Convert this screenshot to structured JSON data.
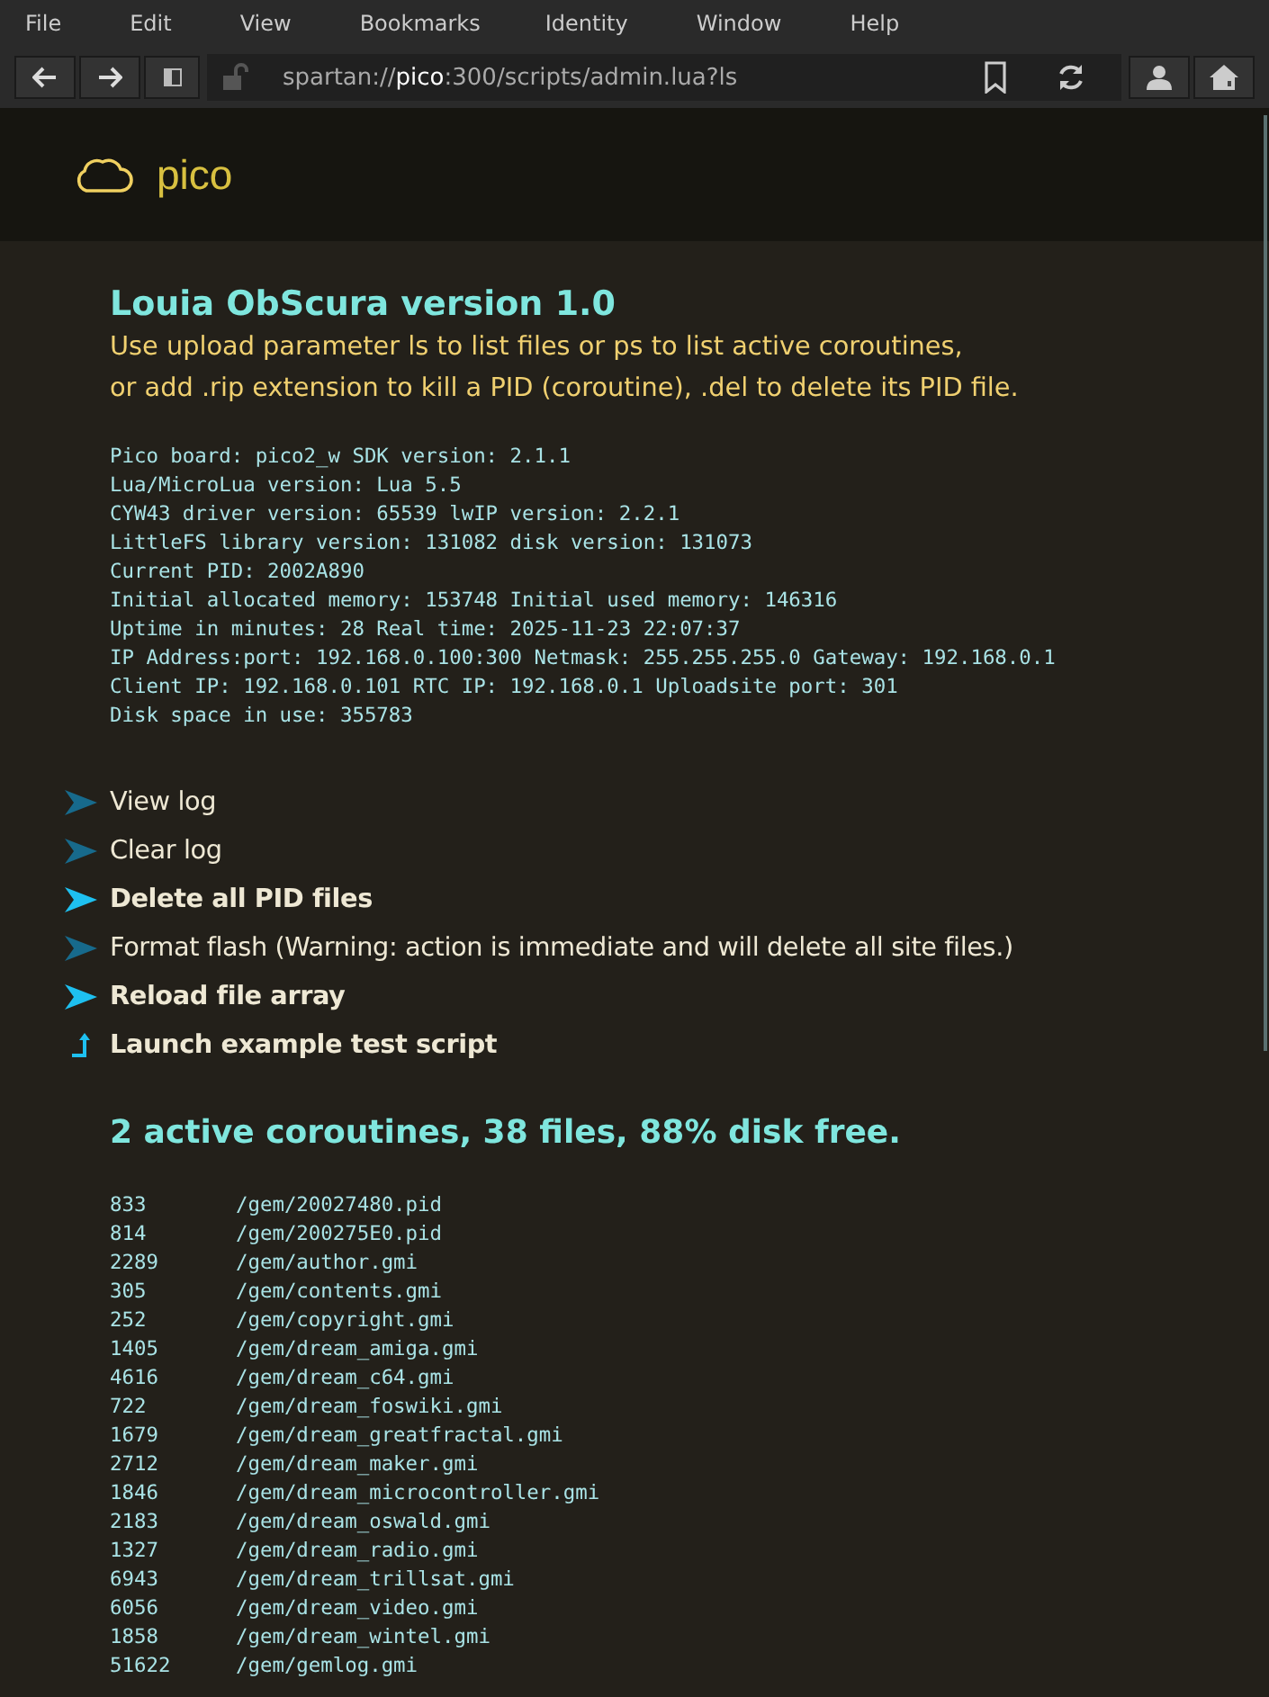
{
  "menu": [
    "File",
    "Edit",
    "View",
    "Bookmarks",
    "Identity",
    "Window",
    "Help"
  ],
  "address": {
    "scheme": "spartan://",
    "host": "pico",
    "path": ":300/scripts/admin.lua?ls"
  },
  "banner": {
    "title": "pico"
  },
  "heading": "Louia ObScura version 1.0",
  "intro": [
    "Use upload parameter ls to list files or ps to list active coroutines,",
    "or add .rip extension to kill a PID (coroutine), .del to delete its PID file."
  ],
  "info": [
    "Pico board: pico2_w SDK version: 2.1.1",
    "Lua/MicroLua version: Lua 5.5",
    "CYW43 driver version: 65539 lwIP version: 2.2.1",
    "LittleFS library version: 131082 disk version: 131073",
    "Current PID: 2002A890",
    "Initial allocated memory: 153748 Initial used memory: 146316",
    "Uptime in minutes: 28 Real time: 2025-11-23 22:07:37",
    "IP Address:port: 192.168.0.100:300 Netmask: 255.255.255.0 Gateway: 192.168.0.1",
    "Client IP: 192.168.0.101 RTC IP: 192.168.0.1 Uploadsite port: 301",
    "Disk space in use: 355783"
  ],
  "links": [
    {
      "kind": "link",
      "label": "View log",
      "visited": true
    },
    {
      "kind": "link",
      "label": "Clear log",
      "visited": true
    },
    {
      "kind": "link",
      "label": "Delete all PID files",
      "visited": false
    },
    {
      "kind": "link",
      "label": "Format flash (Warning: action is immediate and will delete all site files.)",
      "visited": true
    },
    {
      "kind": "link",
      "label": "Reload file array",
      "visited": false
    },
    {
      "kind": "upload",
      "label": "Launch example test script",
      "visited": false
    }
  ],
  "summary": "2 active coroutines, 38 files, 88% disk free.",
  "files": [
    {
      "size": "833",
      "path": "/gem/20027480.pid"
    },
    {
      "size": "814",
      "path": "/gem/200275E0.pid"
    },
    {
      "size": "2289",
      "path": "/gem/author.gmi"
    },
    {
      "size": "305",
      "path": "/gem/contents.gmi"
    },
    {
      "size": "252",
      "path": "/gem/copyright.gmi"
    },
    {
      "size": "1405",
      "path": "/gem/dream_amiga.gmi"
    },
    {
      "size": "4616",
      "path": "/gem/dream_c64.gmi"
    },
    {
      "size": "722",
      "path": "/gem/dream_foswiki.gmi"
    },
    {
      "size": "1679",
      "path": "/gem/dream_greatfractal.gmi"
    },
    {
      "size": "2712",
      "path": "/gem/dream_maker.gmi"
    },
    {
      "size": "1846",
      "path": "/gem/dream_microcontroller.gmi"
    },
    {
      "size": "2183",
      "path": "/gem/dream_oswald.gmi"
    },
    {
      "size": "1327",
      "path": "/gem/dream_radio.gmi"
    },
    {
      "size": "6943",
      "path": "/gem/dream_trillsat.gmi"
    },
    {
      "size": "6056",
      "path": "/gem/dream_video.gmi"
    },
    {
      "size": "1858",
      "path": "/gem/dream_wintel.gmi"
    },
    {
      "size": "51622",
      "path": "/gem/gemlog.gmi"
    }
  ]
}
